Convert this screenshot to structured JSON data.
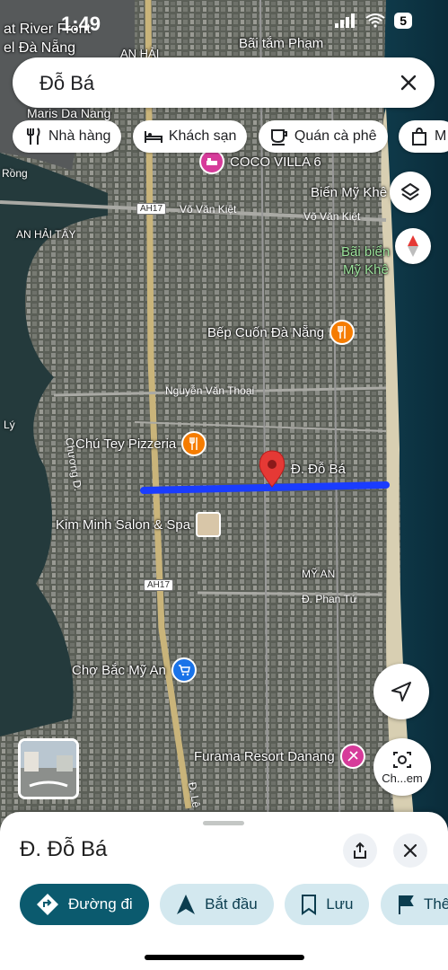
{
  "status": {
    "time": "1:49",
    "battery": "5"
  },
  "search": {
    "value": "Đỗ Bá"
  },
  "chips": [
    {
      "label": "Nhà hàng",
      "icon": "restaurant-icon"
    },
    {
      "label": "Khách sạn",
      "icon": "hotel-icon"
    },
    {
      "label": "Quán cà phê",
      "icon": "coffee-icon"
    },
    {
      "label": "M",
      "icon": "shopping-bag-icon"
    }
  ],
  "map": {
    "pin_label": "Đ. Đỗ Bá",
    "places": [
      {
        "key": "top_left_1",
        "label": "at River Front"
      },
      {
        "key": "top_left_2",
        "label": "el Đà Nẵng"
      },
      {
        "key": "top_right",
        "label": "Bãi tắm Phạm"
      },
      {
        "key": "an_hai",
        "label": "AN HẢI"
      },
      {
        "key": "maris",
        "label": "Maris Da Nang"
      },
      {
        "key": "coco",
        "label": "COCO VILLA 6"
      },
      {
        "key": "bien_my_khe",
        "label": "Biển Mỹ Khê"
      },
      {
        "key": "bai_bien_1",
        "label": "Bãi biển"
      },
      {
        "key": "bai_bien_2",
        "label": "Mỹ Khê"
      },
      {
        "key": "an_hai_tay",
        "label": "AN HẢI TÂY"
      },
      {
        "key": "bep_cuon",
        "label": "Bếp Cuốn Đà Nẵng"
      },
      {
        "key": "chu_tey",
        "label": "Chú Tey Pizzeria"
      },
      {
        "key": "kim_minh",
        "label": "Kim Minh Salon & Spa"
      },
      {
        "key": "cho_bac",
        "label": "Chợ Bắc Mỹ An"
      },
      {
        "key": "furama",
        "label": "Furama Resort Danang"
      },
      {
        "key": "my_an",
        "label": "MỸ AN"
      }
    ],
    "roads": {
      "vo_van_kiet_1": "Võ Văn Kiệt",
      "vo_van_kiet_2": "Võ Văn Kiệt",
      "nguyen_van_thoai": "Nguyễn Văn Thoại",
      "phan_tu": "Đ. Phan Tứ",
      "chuong_d": "Chương D.",
      "le": "Đ. Lê",
      "rong": "Rồng",
      "ly": "Lý",
      "ah17_1": "AH17",
      "ah17_2": "AH17"
    },
    "compass_label": "",
    "camera_label": "Ch...em"
  },
  "sheet": {
    "title": "Đ. Đỗ Bá",
    "actions": [
      {
        "label": "Đường đi",
        "icon": "directions-icon"
      },
      {
        "label": "Bắt đầu",
        "icon": "navigation-arrow-icon"
      },
      {
        "label": "Lưu",
        "icon": "bookmark-icon"
      },
      {
        "label": "Thê",
        "icon": "flag-icon"
      }
    ]
  },
  "colors": {
    "route": "#1a3cff",
    "pin": "#e53935",
    "primary_action": "#0b5a6e",
    "secondary_action": "#d3e8ef"
  }
}
